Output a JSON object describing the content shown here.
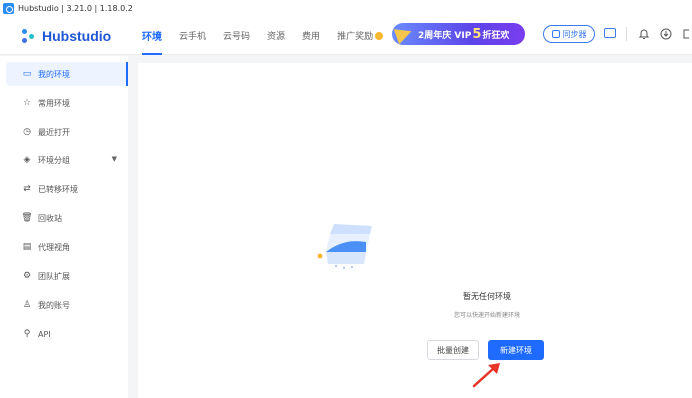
{
  "window": {
    "title": "Hubstudio | 3.21.0 | 1.18.0.2",
    "app_icon": "hubstudio-app-icon"
  },
  "brand": {
    "name": "Hubstudio",
    "logo_icon": "hubstudio-logo-icon",
    "color": "#1f57d6"
  },
  "nav": {
    "tabs": [
      {
        "label": "环境",
        "active": true
      },
      {
        "label": "云手机",
        "active": false
      },
      {
        "label": "云号码",
        "active": false
      },
      {
        "label": "资源",
        "active": false
      },
      {
        "label": "费用",
        "active": false
      },
      {
        "label": "推广奖励",
        "active": false
      }
    ],
    "promo": {
      "part1": "2周年庆 VIP",
      "big": "5",
      "part2": "折狂欢"
    },
    "sync_label": "同步器",
    "icons": [
      "screen-icon",
      "bell-icon",
      "download-icon",
      "exit-icon"
    ],
    "accent_color": "#1f6bff"
  },
  "sidebar": {
    "items": [
      {
        "label": "我的环境",
        "icon": "browser-window-icon",
        "active": true
      },
      {
        "label": "常用环境",
        "icon": "star-icon",
        "active": false
      },
      {
        "label": "最近打开",
        "icon": "clock-icon",
        "active": false
      },
      {
        "label": "环境分组",
        "icon": "layers-icon",
        "active": false,
        "has_chevron": true
      },
      {
        "label": "已转移环境",
        "icon": "transfer-icon",
        "active": false
      },
      {
        "label": "回收站",
        "icon": "trash-icon",
        "active": false
      },
      {
        "label": "代理视角",
        "icon": "proxy-icon",
        "active": false
      },
      {
        "label": "团队扩展",
        "icon": "extension-icon",
        "active": false
      },
      {
        "label": "我的账号",
        "icon": "user-icon",
        "active": false
      },
      {
        "label": "API",
        "icon": "api-plug-icon",
        "active": false
      }
    ]
  },
  "main": {
    "empty_title": "暂无任何环境",
    "empty_subtitle": "您可以快速开始新建环境",
    "batch_create_label": "批量创建",
    "new_env_label": "新建环境",
    "illustration_icon": "empty-box-illustration",
    "annotation_icon": "red-arrow-icon"
  }
}
